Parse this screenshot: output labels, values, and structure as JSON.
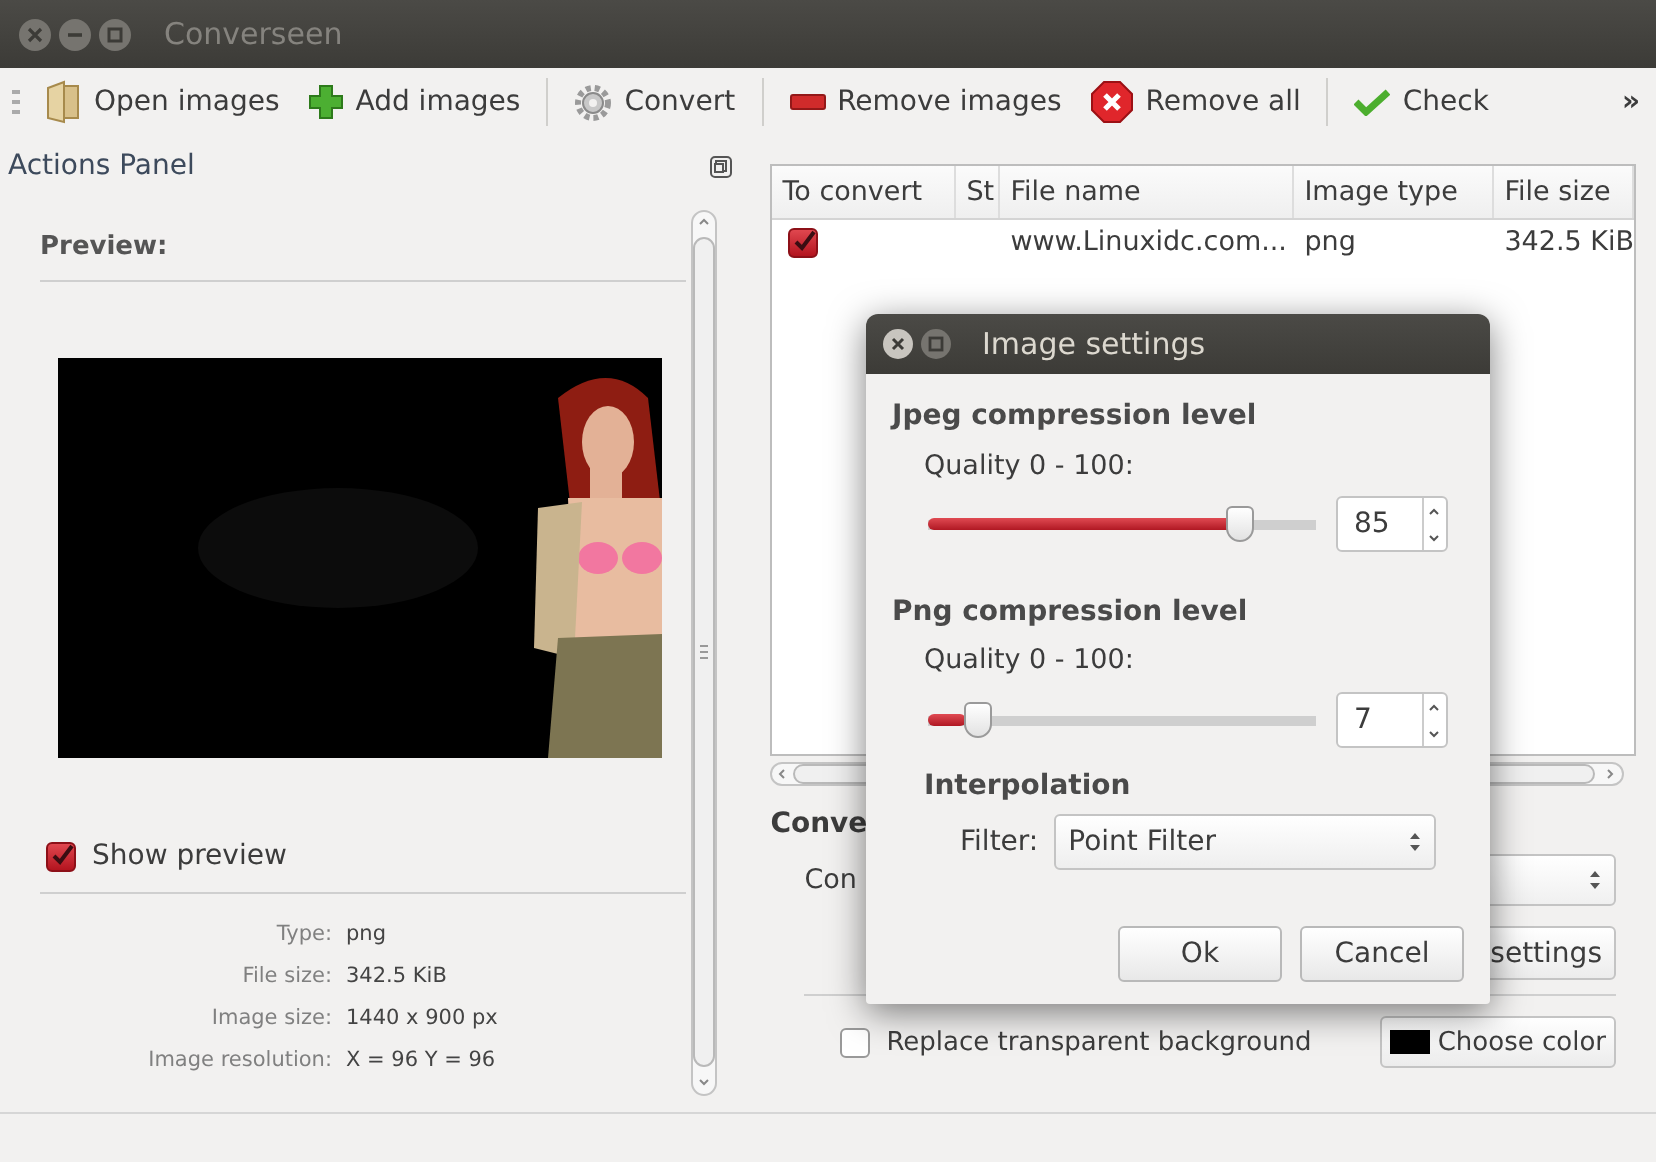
{
  "window": {
    "title": "Converseen"
  },
  "toolbar": {
    "items": [
      {
        "kind": "open",
        "label": "Open images"
      },
      {
        "kind": "add",
        "label": "Add images"
      },
      {
        "kind": "separator"
      },
      {
        "kind": "convert",
        "label": "Convert"
      },
      {
        "kind": "separator"
      },
      {
        "kind": "remove",
        "label": "Remove images"
      },
      {
        "kind": "remove-all",
        "label": "Remove all"
      },
      {
        "kind": "separator"
      },
      {
        "kind": "check",
        "label": "Check"
      }
    ],
    "overflow": "»"
  },
  "actions_panel": {
    "title": "Actions Panel",
    "preview_heading": "Preview:",
    "show_preview": {
      "label": "Show preview",
      "checked": true
    },
    "info": [
      {
        "label": "Type:",
        "value": "png"
      },
      {
        "label": "File size:",
        "value": "342.5 KiB"
      },
      {
        "label": "Image size:",
        "value": "1440 x 900 px"
      },
      {
        "label": "Image resolution:",
        "value": "X = 96 Y = 96"
      }
    ]
  },
  "file_table": {
    "columns": [
      "To convert",
      "St",
      "File name",
      "Image type",
      "File size"
    ],
    "rows": [
      {
        "to_convert": true,
        "file_name": "www.Linuxidc.com...",
        "image_type": "png",
        "file_size": "342.5 KiB"
      }
    ]
  },
  "conversion": {
    "heading": "Conve",
    "format_label": "Con",
    "settings_button": "settings",
    "replace_background": {
      "label": "Replace transparent background",
      "checked": false
    },
    "choose_color_button": "Choose color"
  },
  "dialog": {
    "title": "Image settings",
    "jpeg": {
      "heading": "Jpeg compression level",
      "quality_label": "Quality 0 - 100:",
      "level": 0.83,
      "value": "85"
    },
    "png": {
      "heading": "Png compression level",
      "quality_label": "Quality 0 - 100:",
      "level": 0.1,
      "value": "7"
    },
    "interpolation": {
      "heading": "Interpolation",
      "filter_label": "Filter:",
      "filter_value": "Point Filter"
    },
    "buttons": [
      "Ok",
      "Cancel"
    ]
  }
}
